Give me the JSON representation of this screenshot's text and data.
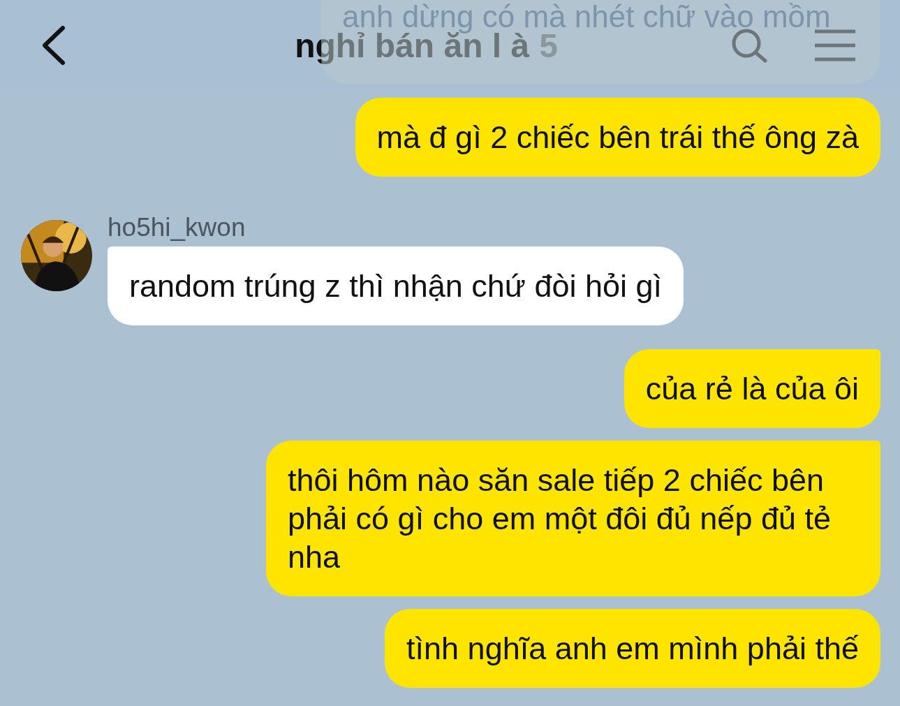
{
  "header": {
    "title": "nghỉ bán ăn l à",
    "member_count": "5"
  },
  "hidden_message": {
    "text": "anh dừng có mà nhét chữ vào mồm"
  },
  "messages": [
    {
      "kind": "sent",
      "tail": false,
      "text": "mà đ gì 2 chiếc bên trái thế ông zà"
    },
    {
      "kind": "received",
      "tail": true,
      "sender": "ho5hi_kwon",
      "text": "random trúng z thì nhận chứ đòi hỏi gì"
    },
    {
      "kind": "sent",
      "tail": true,
      "text": "của rẻ là của ôi"
    },
    {
      "kind": "sent",
      "tail": true,
      "text": "thôi hôm nào săn sale tiếp 2 chiếc bên phải có gì cho em một đôi đủ nếp đủ tẻ nha"
    },
    {
      "kind": "sent",
      "tail": false,
      "text": "tình nghĩa anh em mình phải thế"
    }
  ]
}
